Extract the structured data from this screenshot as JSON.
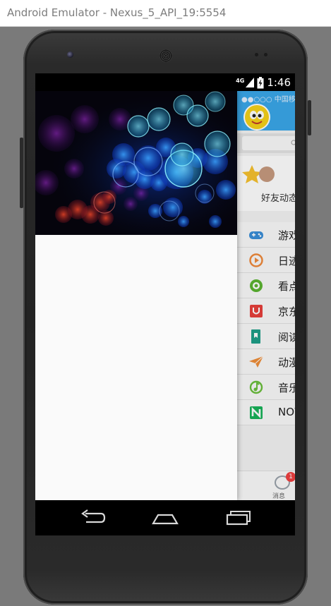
{
  "window": {
    "title": "Android Emulator - Nexus_5_API_19:5554"
  },
  "status_bar": {
    "network": "4G",
    "time": "1:46"
  },
  "background_app": {
    "carrier": "●●○○○ 中国移动",
    "friends_feed_label": "好友动态",
    "menu_items": [
      {
        "label": "游戏",
        "icon": "gamepad-icon",
        "color": "#3a8fd8"
      },
      {
        "label": "日迹",
        "icon": "play-circle-icon",
        "color": "#f08a3c"
      },
      {
        "label": "看点",
        "icon": "eye-icon",
        "color": "#5cb531"
      },
      {
        "label": "京东",
        "icon": "shopping-bag-icon",
        "color": "#e8413c"
      },
      {
        "label": "阅读",
        "icon": "book-icon",
        "color": "#1e9f88"
      },
      {
        "label": "动漫",
        "icon": "paper-plane-icon",
        "color": "#ef8f3a"
      },
      {
        "label": "音乐",
        "icon": "music-note-icon",
        "color": "#6bbf3c"
      },
      {
        "label": "NOW",
        "icon": "now-logo-icon",
        "color": "#18b25a"
      }
    ],
    "bottom_tab": {
      "label": "消息",
      "badge": "1"
    }
  },
  "colors": {
    "accent": "#3aa8ea",
    "drawer_body": "#fafafa"
  }
}
